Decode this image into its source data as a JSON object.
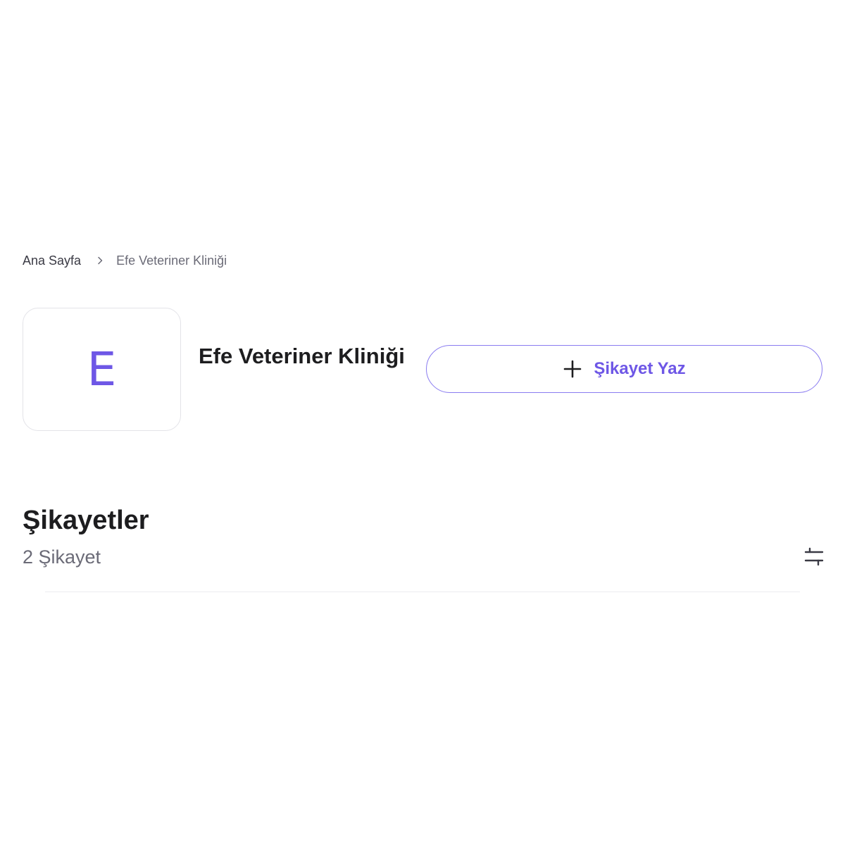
{
  "breadcrumb": {
    "home": "Ana Sayfa",
    "separator_icon": "chevron-right-icon",
    "current": "Efe Veteriner Kliniği"
  },
  "company": {
    "logo_letter": "E",
    "name": "Efe Veteriner Kliniği"
  },
  "actions": {
    "write_complaint_label": "Şikayet Yaz",
    "write_complaint_icon": "plus-icon"
  },
  "complaints": {
    "title": "Şikayetler",
    "count_text": "2 Şikayet",
    "filter_icon": "sliders-icon"
  },
  "colors": {
    "accent": "#6e57e6",
    "button_border": "#8a7cf0",
    "muted_text": "#6b6b77",
    "border": "#e3e3e8"
  }
}
